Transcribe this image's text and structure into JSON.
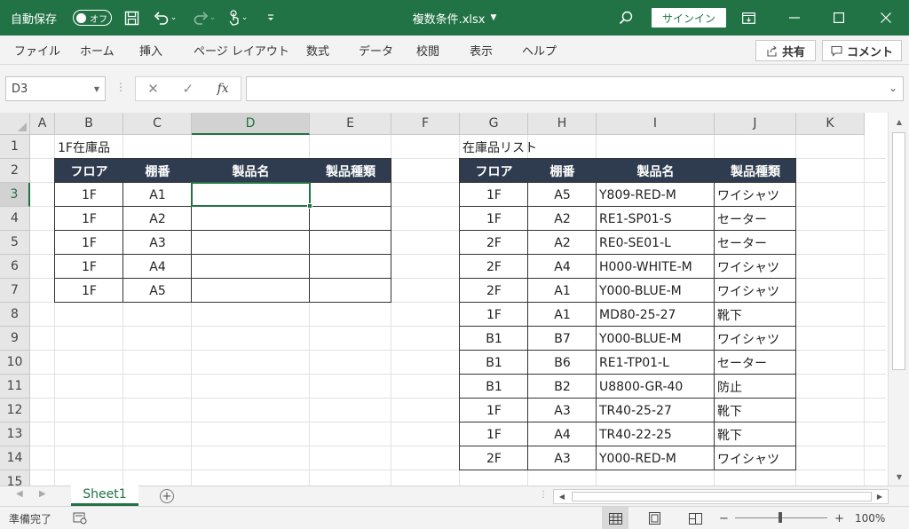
{
  "titlebar": {
    "autosave_label": "自動保存",
    "autosave_state": "オフ",
    "doc_title": "複数条件.xlsx",
    "signin_label": "サインイン"
  },
  "ribbon": {
    "tabs": [
      "ファイル",
      "ホーム",
      "挿入",
      "ページ レイアウト",
      "数式",
      "データ",
      "校閲",
      "表示",
      "ヘルプ"
    ],
    "share_label": "共有",
    "comment_label": "コメント"
  },
  "formula_bar": {
    "name_box": "D3",
    "formula": ""
  },
  "grid": {
    "columns": [
      "A",
      "B",
      "C",
      "D",
      "E",
      "F",
      "G",
      "H",
      "I",
      "J",
      "K"
    ],
    "selected_column": "D",
    "rows": [
      "1",
      "2",
      "3",
      "4",
      "5",
      "6",
      "7",
      "8",
      "9",
      "10",
      "11",
      "12",
      "13",
      "14",
      "15"
    ],
    "selected_row": "3",
    "left_table": {
      "title": "1F在庫品",
      "headers": [
        "フロア",
        "棚番",
        "製品名",
        "製品種類"
      ],
      "rows": [
        [
          "1F",
          "A1",
          "",
          ""
        ],
        [
          "1F",
          "A2",
          "",
          ""
        ],
        [
          "1F",
          "A3",
          "",
          ""
        ],
        [
          "1F",
          "A4",
          "",
          ""
        ],
        [
          "1F",
          "A5",
          "",
          ""
        ]
      ]
    },
    "right_table": {
      "title": "在庫品リスト",
      "headers": [
        "フロア",
        "棚番",
        "製品名",
        "製品種類"
      ],
      "rows": [
        [
          "1F",
          "A5",
          "Y809-RED-M",
          "ワイシャツ"
        ],
        [
          "1F",
          "A2",
          "RE1-SP01-S",
          "セーター"
        ],
        [
          "2F",
          "A2",
          "RE0-SE01-L",
          "セーター"
        ],
        [
          "2F",
          "A4",
          "H000-WHITE-M",
          "ワイシャツ"
        ],
        [
          "2F",
          "A1",
          "Y000-BLUE-M",
          "ワイシャツ"
        ],
        [
          "1F",
          "A1",
          "MD80-25-27",
          "靴下"
        ],
        [
          "B1",
          "B7",
          "Y000-BLUE-M",
          "ワイシャツ"
        ],
        [
          "B1",
          "B6",
          "RE1-TP01-L",
          "セーター"
        ],
        [
          "B1",
          "B2",
          "U8800-GR-40",
          "防止"
        ],
        [
          "1F",
          "A3",
          "TR40-25-27",
          "靴下"
        ],
        [
          "1F",
          "A4",
          "TR40-22-25",
          "靴下"
        ],
        [
          "2F",
          "A3",
          "Y000-RED-M",
          "ワイシャツ"
        ]
      ]
    }
  },
  "sheet_tabs": {
    "active": "Sheet1"
  },
  "statusbar": {
    "ready": "準備完了",
    "zoom": "100%"
  },
  "colors": {
    "excel_green": "#217346",
    "table_header": "#2f3c4f"
  }
}
